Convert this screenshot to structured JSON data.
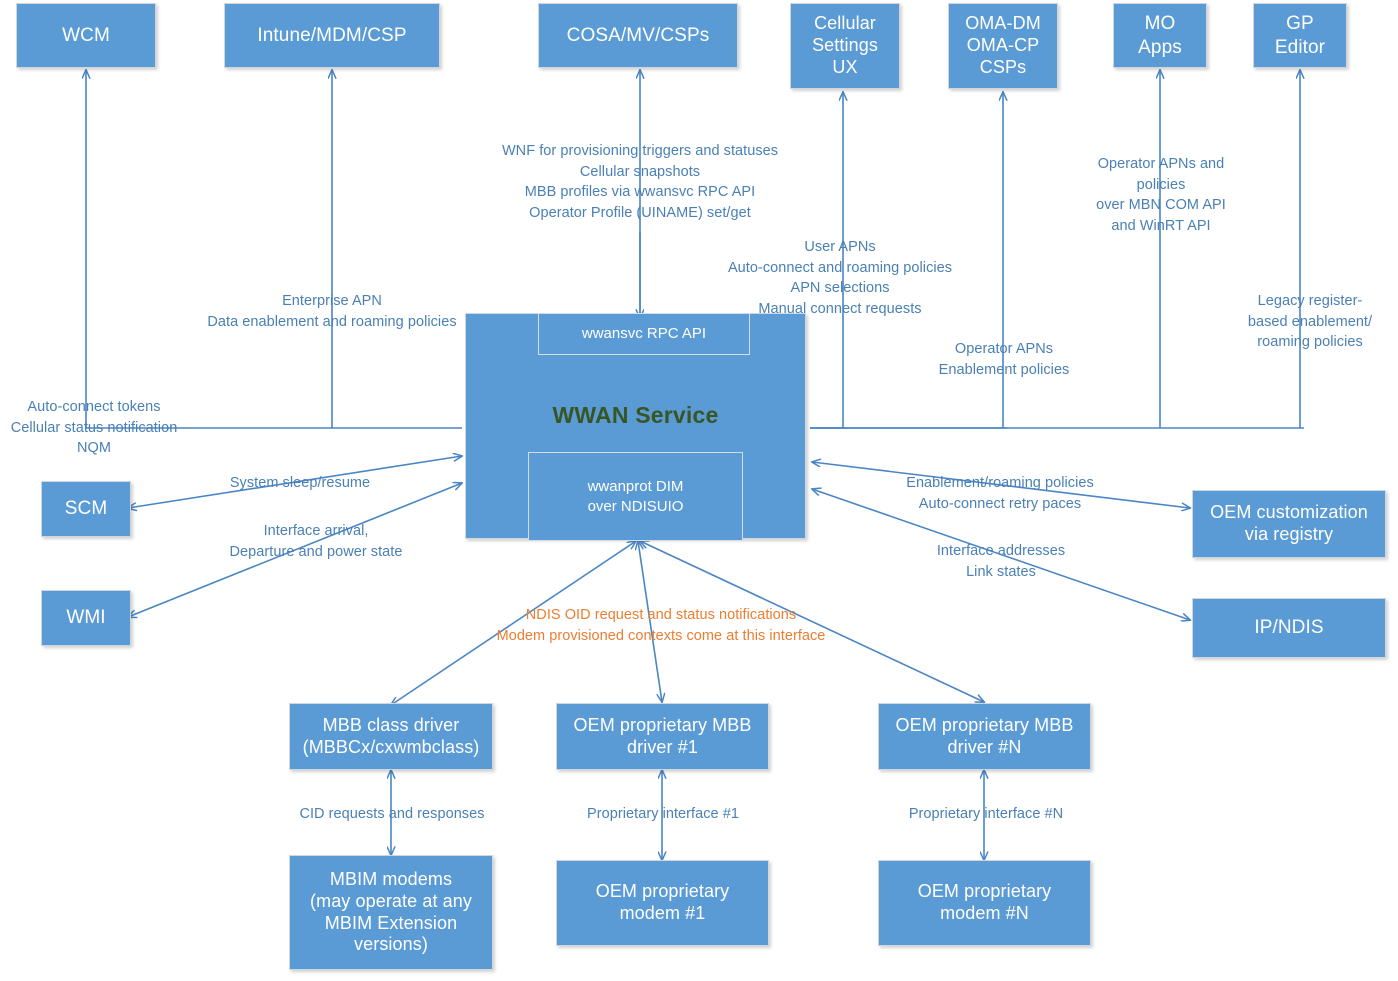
{
  "diagram": {
    "title": "WWAN Service architecture",
    "colors": {
      "node_fill": "#5B9BD5",
      "node_text": "#FFFFFF",
      "edge_line": "#5B9BD5",
      "edge_label": "#4A80B4",
      "highlight_label": "#ED7D31",
      "service_title": "#375623",
      "background": "#FFFFFF"
    },
    "nodes": {
      "wcm": "WCM",
      "intune": "Intune/MDM/CSP",
      "cosa": "COSA/MV/CSPs",
      "cellular_settings_ux": "Cellular\nSettings\nUX",
      "oma_csps": "OMA-DM\nOMA-CP\nCSPs",
      "mo_apps": "MO\nApps",
      "gp_editor": "GP\nEditor",
      "scm": "SCM",
      "wmi": "WMI",
      "oem_customization": "OEM customization\nvia registry",
      "ip_ndis": "IP/NDIS",
      "wwan_service": "WWAN Service",
      "wwansvc_rpc_api": "wwansvc RPC API",
      "wwanprot_dim": "wwanprot DIM\nover NDISUIO",
      "mbb_class_driver": "MBB class driver\n(MBBCx/cxwmbclass)",
      "oem_mbb_driver_1": "OEM proprietary MBB\ndriver #1",
      "oem_mbb_driver_n": "OEM proprietary MBB\ndriver #N",
      "mbim_modems": "MBIM modems\n(may operate at any\nMBIM Extension\nversions)",
      "oem_modem_1": "OEM proprietary\nmodem #1",
      "oem_modem_n": "OEM proprietary\nmodem #N"
    },
    "edge_labels": {
      "cosa_stack": "WNF for provisioning triggers and statuses\nCellular snapshots\nMBB profiles via wwansvc RPC API\nOperator Profile (UINAME) set/get",
      "enterprise_apn": "Enterprise APN\nData enablement and roaming policies",
      "wcm_stack": "Auto-connect tokens\nCellular status notification\nNQM",
      "user_apns": "User APNs\nAuto-connect and roaming policies\nAPN selections\nManual connect requests",
      "mo_apps_stack": "Operator APNs and\npolicies\nover MBN COM API\nand WinRT API",
      "legacy_register": "Legacy register-\nbased enablement/\nroaming policies",
      "operator_apns": "Operator APNs\nEnablement policies",
      "system_sleep": "System sleep/resume",
      "interface_arrival": "Interface arrival,\nDeparture and power state",
      "enablement_roaming": "Enablement/roaming policies\nAuto-connect retry paces",
      "interface_addresses": "Interface addresses\nLink states",
      "ndis_oid": "NDIS OID request and status notifications\nModem provisioned contexts come at this interface",
      "cid_requests": "CID requests and responses",
      "proprietary_interface_1": "Proprietary interface #1",
      "proprietary_interface_n": "Proprietary interface #N"
    }
  }
}
